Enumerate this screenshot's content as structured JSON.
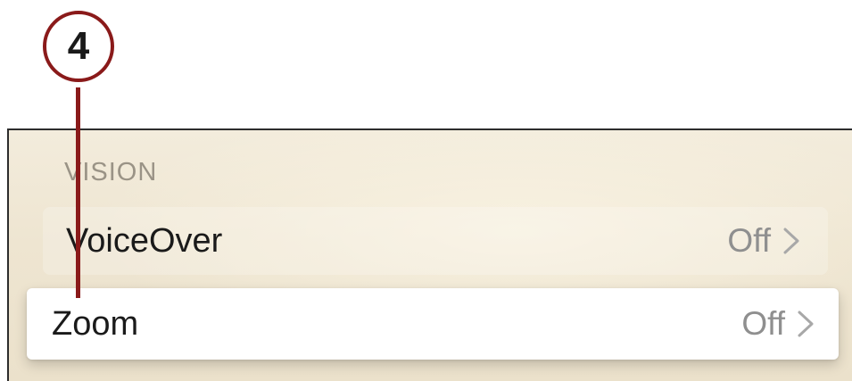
{
  "callout": {
    "number": "4",
    "color": "#8a1a1a"
  },
  "section": {
    "header": "VISION"
  },
  "rows": [
    {
      "label": "VoiceOver",
      "value": "Off",
      "icon": "chevron-right-icon"
    },
    {
      "label": "Zoom",
      "value": "Off",
      "icon": "chevron-right-icon",
      "focused": true
    }
  ],
  "colors": {
    "background": "#f3ecdc",
    "label": "#1a1a1a",
    "value": "#8f8f8f",
    "header": "#9a9386"
  }
}
